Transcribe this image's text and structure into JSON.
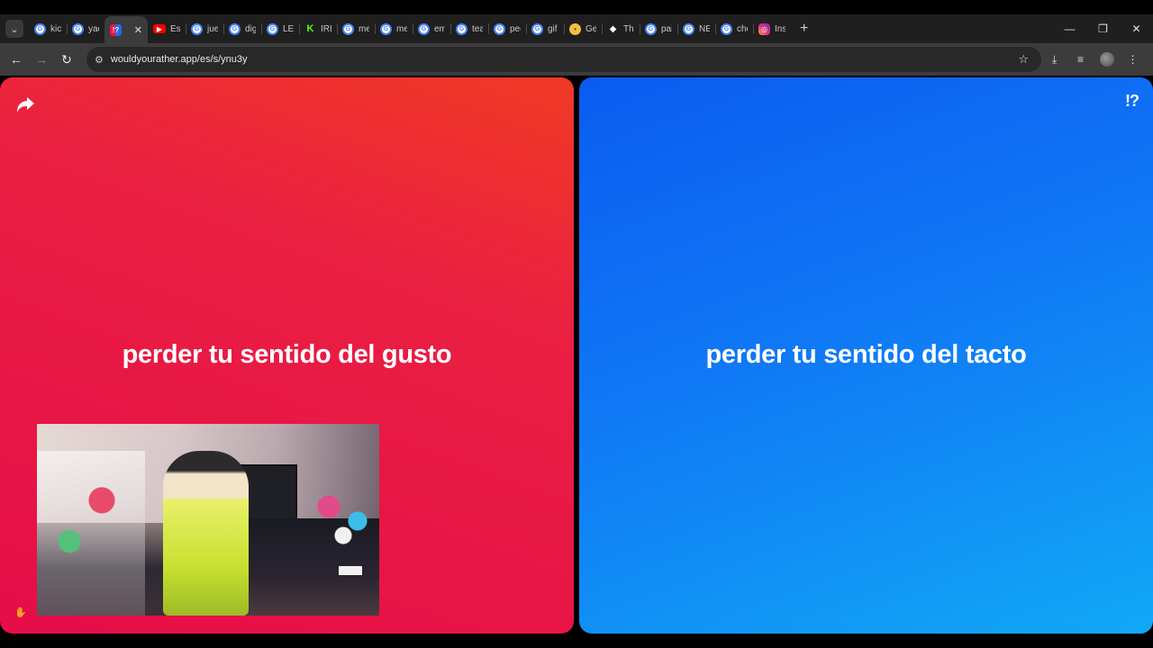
{
  "browser": {
    "tabs": [
      {
        "label": "kick",
        "favicon": "google-icon"
      },
      {
        "label": "yao",
        "favicon": "google-icon"
      },
      {
        "label": "",
        "favicon": "wouldyourather-icon",
        "active": true
      },
      {
        "label": "Esta",
        "favicon": "youtube-icon"
      },
      {
        "label": "jueg",
        "favicon": "google-icon"
      },
      {
        "label": "digi",
        "favicon": "google-icon"
      },
      {
        "label": "LET",
        "favicon": "google-icon"
      },
      {
        "label": "IRL",
        "favicon": "kick-icon"
      },
      {
        "label": "mer",
        "favicon": "google-icon"
      },
      {
        "label": "mer",
        "favicon": "google-icon"
      },
      {
        "label": "em",
        "favicon": "google-icon"
      },
      {
        "label": "teat",
        "favicon": "google-icon"
      },
      {
        "label": "peo",
        "favicon": "google-icon"
      },
      {
        "label": "gif",
        "favicon": "google-icon"
      },
      {
        "label": "Get",
        "favicon": "emoji-icon"
      },
      {
        "label": "The",
        "favicon": "diamond-icon"
      },
      {
        "label": "pair",
        "favicon": "google-icon"
      },
      {
        "label": "NEL",
        "favicon": "google-icon"
      },
      {
        "label": "cho",
        "favicon": "google-icon"
      },
      {
        "label": "Inst",
        "favicon": "instagram-icon"
      }
    ],
    "url": "wouldyourather.app/es/s/ynu3y"
  },
  "game": {
    "option_a": "perder tu sentido del gusto",
    "option_b": "perder tu sentido del tacto",
    "help_label": "!?"
  },
  "colors": {
    "option_a": "#e8184a",
    "option_b": "#1a6cf5"
  }
}
